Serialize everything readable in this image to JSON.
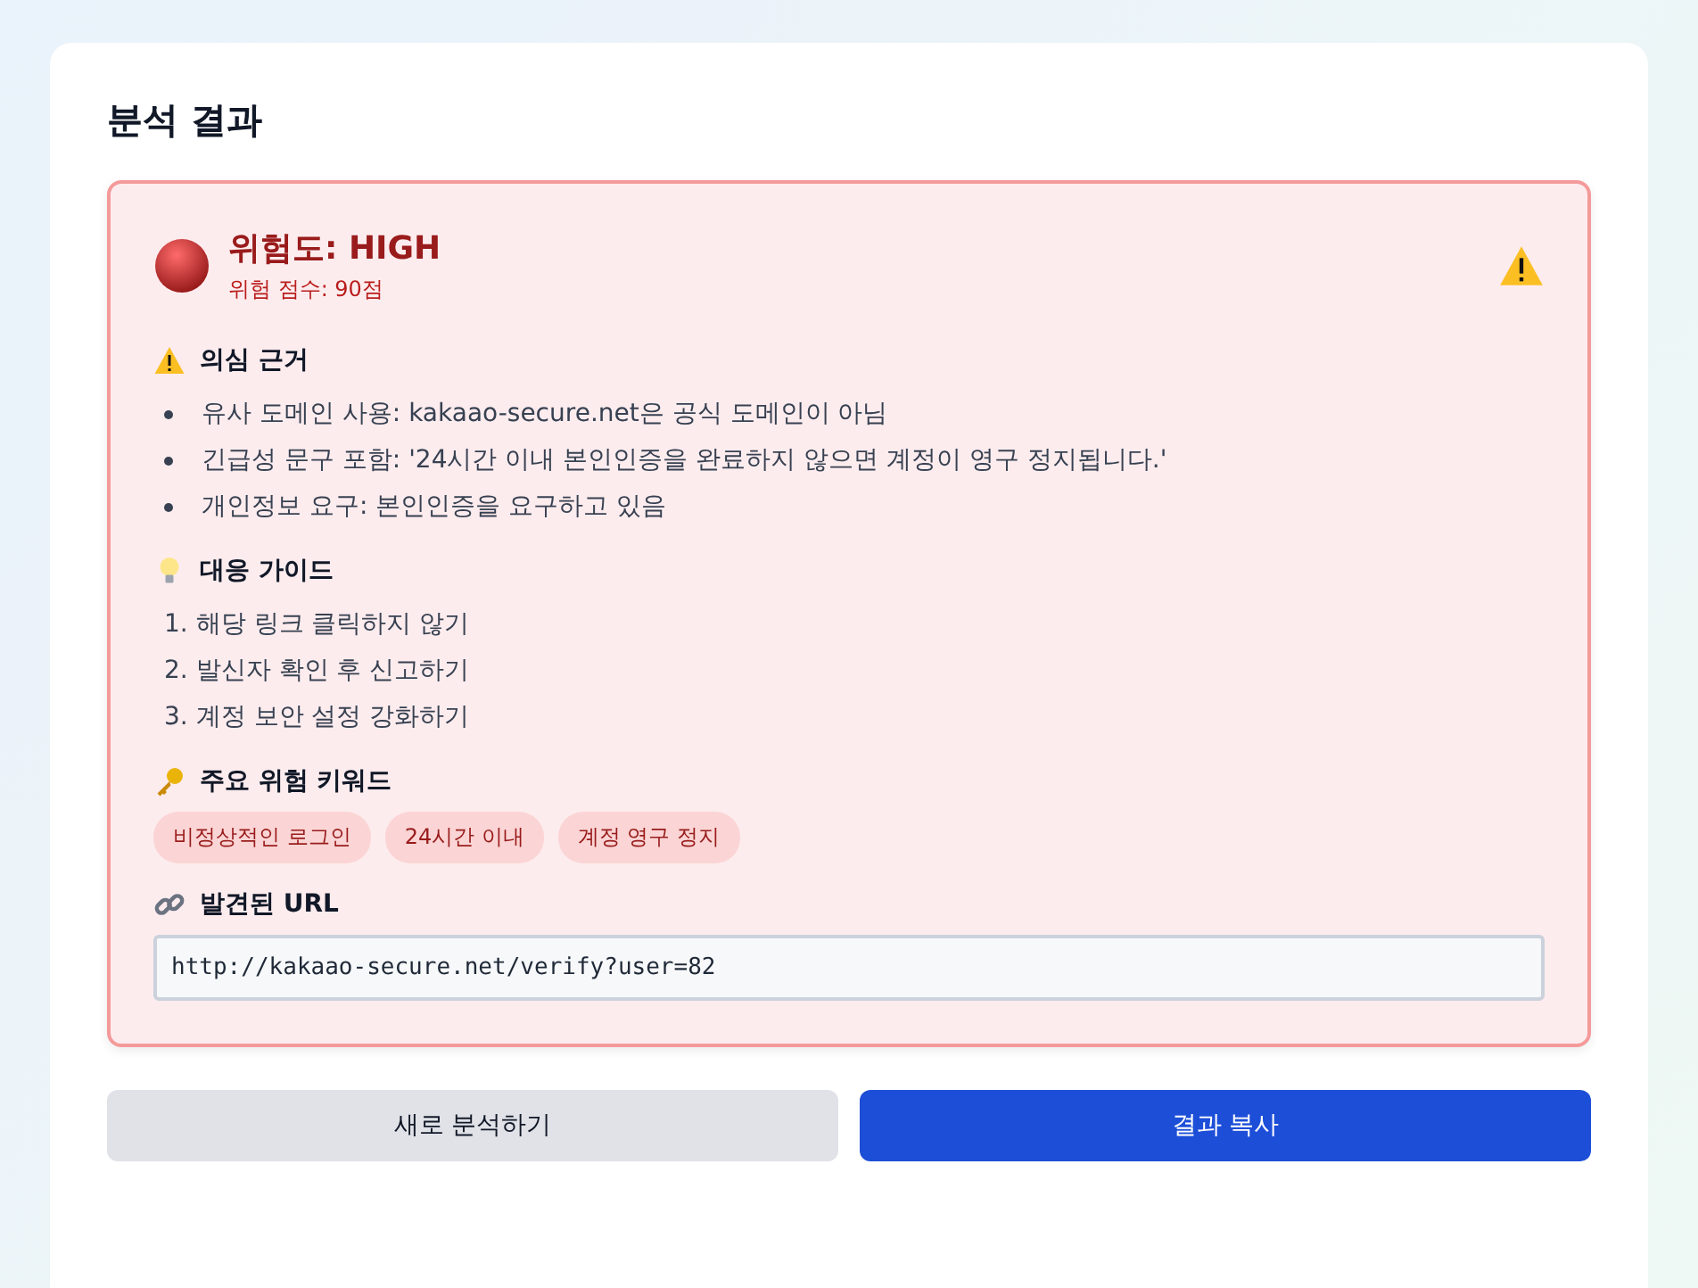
{
  "title": "분석 결과",
  "result": {
    "heading": "위험도: HIGH",
    "score": "위험 점수: 90점",
    "sections": [
      {
        "kind": "bullets",
        "title": "의심 근거",
        "items": [
          "유사 도메인 사용: kakaao-secure.net은 공식 도메인이 아님",
          "긴급성 문구 포함: '24시간 이내 본인인증을 완료하지 않으면 계정이 영구 정지됩니다.'",
          "개인정보 요구: 본인인증을 요구하고 있음"
        ]
      },
      {
        "kind": "numbered",
        "title": "대응 가이드",
        "items": [
          "1. 해당 링크 클릭하지 않기",
          "2. 발신자 확인 후 신고하기",
          "3. 계정 보안 설정 강화하기"
        ]
      },
      {
        "kind": "tags",
        "title": "주요 위험 키워드",
        "items": [
          "비정상적인 로그인",
          "24시간 이내",
          "계정 영구 정지"
        ]
      },
      {
        "kind": "url",
        "title": "발견된 URL",
        "value": "http://kakaao-secure.net/verify?user=82"
      }
    ]
  },
  "buttons": [
    {
      "kind": "secondary",
      "label": "새로 분석하기"
    },
    {
      "kind": "primary",
      "label": "결과 복사"
    }
  ]
}
